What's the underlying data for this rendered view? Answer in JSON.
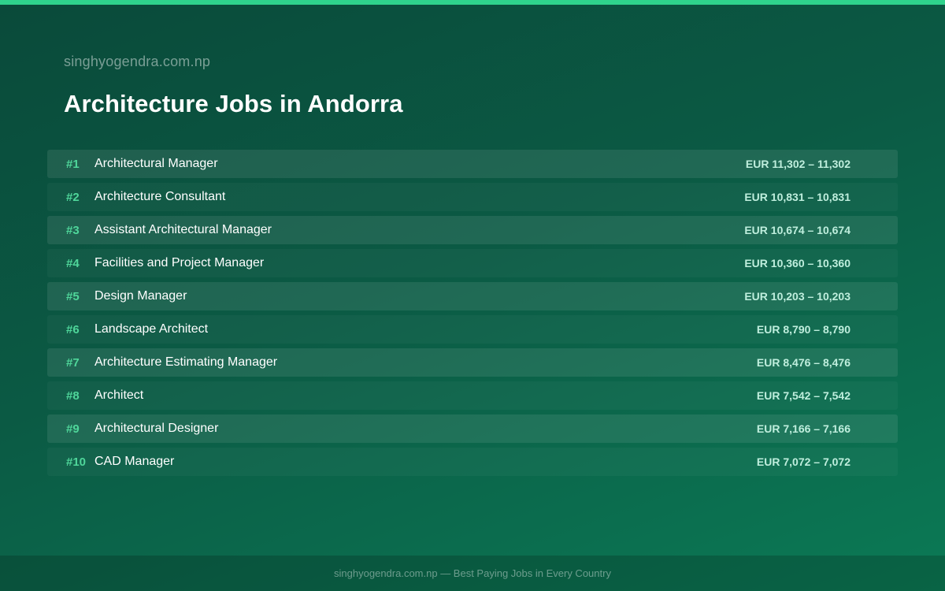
{
  "site": "singhyogendra.com.np",
  "title": "Architecture Jobs in Andorra",
  "jobs": [
    {
      "rank": "#1",
      "name": "Architectural Manager",
      "salary": "EUR 11,302 – 11,302"
    },
    {
      "rank": "#2",
      "name": "Architecture Consultant",
      "salary": "EUR 10,831 – 10,831"
    },
    {
      "rank": "#3",
      "name": "Assistant Architectural Manager",
      "salary": "EUR 10,674 – 10,674"
    },
    {
      "rank": "#4",
      "name": "Facilities and Project Manager",
      "salary": "EUR 10,360 – 10,360"
    },
    {
      "rank": "#5",
      "name": "Design Manager",
      "salary": "EUR 10,203 – 10,203"
    },
    {
      "rank": "#6",
      "name": "Landscape Architect",
      "salary": "EUR 8,790 – 8,790"
    },
    {
      "rank": "#7",
      "name": "Architecture Estimating Manager",
      "salary": "EUR 8,476 – 8,476"
    },
    {
      "rank": "#8",
      "name": "Architect",
      "salary": "EUR 7,542 – 7,542"
    },
    {
      "rank": "#9",
      "name": "Architectural Designer",
      "salary": "EUR 7,166 – 7,166"
    },
    {
      "rank": "#10",
      "name": "CAD Manager",
      "salary": "EUR 7,072 – 7,072"
    }
  ],
  "footer": "singhyogendra.com.np — Best Paying Jobs in Every Country",
  "colors": {
    "accent": "#2fd38c",
    "rank": "#4fd69a",
    "salary": "#bfeedd"
  }
}
